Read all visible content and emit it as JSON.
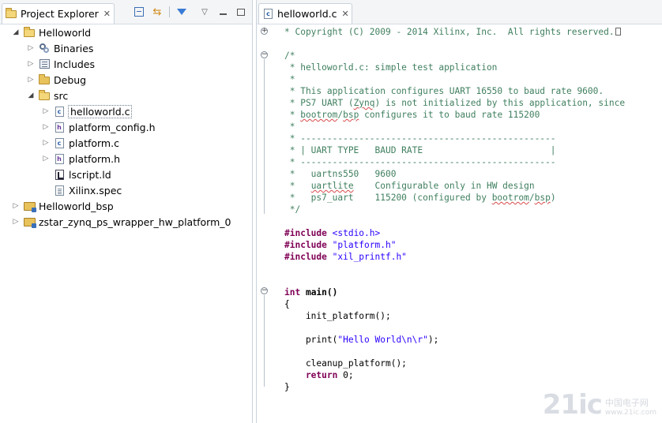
{
  "explorer": {
    "tab_label": "Project Explorer",
    "tree": [
      {
        "label": "Helloworld",
        "icon": "project-folder-icon",
        "expanded": true
      },
      {
        "label": "Binaries",
        "icon": "binaries-icon",
        "expanded": false
      },
      {
        "label": "Includes",
        "icon": "includes-icon",
        "expanded": false
      },
      {
        "label": "Debug",
        "icon": "folder-icon",
        "expanded": false
      },
      {
        "label": "src",
        "icon": "folder-open-icon",
        "expanded": true
      },
      {
        "label": "helloworld.c",
        "icon": "c-file-icon",
        "selected": true
      },
      {
        "label": "platform_config.h",
        "icon": "h-file-icon"
      },
      {
        "label": "platform.c",
        "icon": "c-file-icon"
      },
      {
        "label": "platform.h",
        "icon": "h-file-icon"
      },
      {
        "label": "lscript.ld",
        "icon": "linker-script-icon"
      },
      {
        "label": "Xilinx.spec",
        "icon": "spec-file-icon"
      },
      {
        "label": "Helloworld_bsp",
        "icon": "project-folder-icon",
        "expanded": false
      },
      {
        "label": "zstar_zynq_ps_wrapper_hw_platform_0",
        "icon": "project-folder-icon",
        "expanded": false
      }
    ],
    "toolbar": {
      "collapse_all": "collapse-all-icon",
      "link_editor": "link-with-editor-icon",
      "filter": "filter-icon",
      "view_menu": "view-menu-icon",
      "minimize": "minimize-icon",
      "maximize": "maximize-icon"
    }
  },
  "editor": {
    "tab_label": "helloworld.c",
    "code": {
      "l0": "* Copyright (C) 2009 - 2014 Xilinx, Inc.  All rights reserved.",
      "l1": "/*",
      "l2": " * helloworld.c: simple test application",
      "l3": " *",
      "l4": " * This application configures UART 16550 to baud rate 9600.",
      "l5a": " * PS7 UART (",
      "l5b": "Zynq",
      "l5c": ") is not initialized by this application, since",
      "l6a": " * ",
      "l6b": "bootrom",
      "l6c": "/",
      "l6d": "bsp",
      "l6e": " configures it to baud rate 115200",
      "l7": " *",
      "l8": " * ------------------------------------------------",
      "l9": " * | UART TYPE   BAUD RATE                        |",
      "l10": " * ------------------------------------------------",
      "l11": " *   uartns550   9600",
      "l12a": " *   ",
      "l12b": "uartlite",
      "l12c": "    Configurable only in HW design",
      "l13a": " *   ps7_uart    115200 (configured by ",
      "l13b": "bootrom",
      "l13c": "/",
      "l13d": "bsp",
      "l13e": ")",
      "l14": " */",
      "inc_kw": "#include",
      "inc1": " <stdio.h>",
      "inc2": " \"platform.h\"",
      "inc3": " \"xil_printf.h\"",
      "main_kw": "int",
      "main_rest": " main()",
      "brace_open": "{",
      "call1": "    init_platform();",
      "print_a": "    print(",
      "print_b": "\"Hello World\\n\\r\"",
      "print_c": ");",
      "call3": "    cleanup_platform();",
      "ret_kw": "    return",
      "ret_rest": " 0;",
      "brace_close": "}"
    }
  },
  "watermark": {
    "big": "21ic",
    "small1": "中国电子网",
    "small2": "www.21ic.com"
  },
  "colors": {
    "comment": "#3f7f5f",
    "keyword": "#7f0055",
    "string": "#2a00ff"
  }
}
